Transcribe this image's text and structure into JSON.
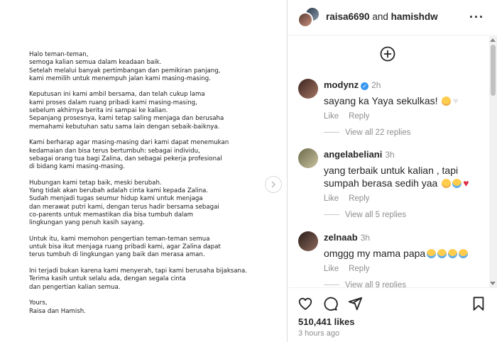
{
  "post_image": {
    "letter_paragraphs": [
      [
        "Halo teman-teman,",
        "semoga kalian semua dalam keadaan baik.",
        "Setelah melalui banyak pertimbangan dan pemikiran panjang,",
        "kami memilih untuk menempuh jalan kami masing-masing."
      ],
      [
        "Keputusan ini kami ambil bersama, dan telah cukup lama",
        "kami proses dalam ruang pribadi kami masing-masing,",
        "sebelum akhirnya berita ini sampai ke kalian.",
        "Sepanjang prosesnya, kami tetap saling menjaga dan berusaha",
        "memahami kebutuhan satu sama lain dengan sebaik-baiknya."
      ],
      [
        "Kami berharap agar masing-masing dari kami dapat menemukan",
        "kedamaian dan bisa terus bertumbuh: sebagai individu,",
        "sebagai orang tua bagi Zalina, dan sebagai pekerja profesional",
        "di bidang kami masing-masing."
      ],
      [
        "Hubungan kami tetap baik, meski berubah.",
        "Yang tidak akan berubah adalah cinta kami kepada Zalina.",
        "Sudah menjadi tugas seumur hidup kami untuk menjaga",
        "dan merawat putri kami, dengan terus hadir bersama sebagai",
        "co-parents untuk memastikan dia bisa tumbuh dalam",
        "lingkungan yang penuh kasih sayang."
      ],
      [
        "Untuk itu, kami memohon pengertian teman-teman semua",
        "untuk bisa ikut menjaga ruang pribadi kami, agar Zalina dapat",
        "terus tumbuh di lingkungan yang baik dan merasa aman."
      ],
      [
        "Ini terjadi bukan karena kami menyerah, tapi kami berusaha bijaksana.",
        "Terima kasih untuk selalu ada, dengan segala cinta",
        "dan pengertian kalian semua."
      ],
      [
        "Yours,",
        "Raisa dan Hamish."
      ]
    ]
  },
  "header": {
    "user1": "raisa6690",
    "joiner": "and",
    "user2": "hamishdw"
  },
  "comments": [
    {
      "username": "modynz",
      "verified": true,
      "time": "2h",
      "text": "sayang ka Yaya sekulkas!",
      "emojis": [
        "pleading-face",
        "white-heart"
      ],
      "like_label": "Like",
      "reply_label": "Reply",
      "view_replies": "View all 22 replies"
    },
    {
      "username": "angelabeliani",
      "verified": false,
      "time": "3h",
      "text": "yang terbaik untuk kalian , tapi sumpah berasa sedih yaa",
      "emojis": [
        "pleading-face",
        "crying-face",
        "broken-heart"
      ],
      "like_label": "Like",
      "reply_label": "Reply",
      "view_replies": "View all 5 replies"
    },
    {
      "username": "zelnaab",
      "verified": false,
      "time": "3h",
      "text": "omggg my mama papa",
      "emojis": [
        "crying-face",
        "crying-face",
        "crying-face",
        "crying-face"
      ],
      "like_label": "Like",
      "reply_label": "Reply",
      "view_replies": "View all 9 replies"
    }
  ],
  "footer": {
    "likes": "510,441 likes",
    "time_ago": "3 hours ago"
  },
  "colors": {
    "verified_badge": "#3897f0",
    "secondary_text": "#8e8e8e",
    "primary_text": "#262626"
  }
}
